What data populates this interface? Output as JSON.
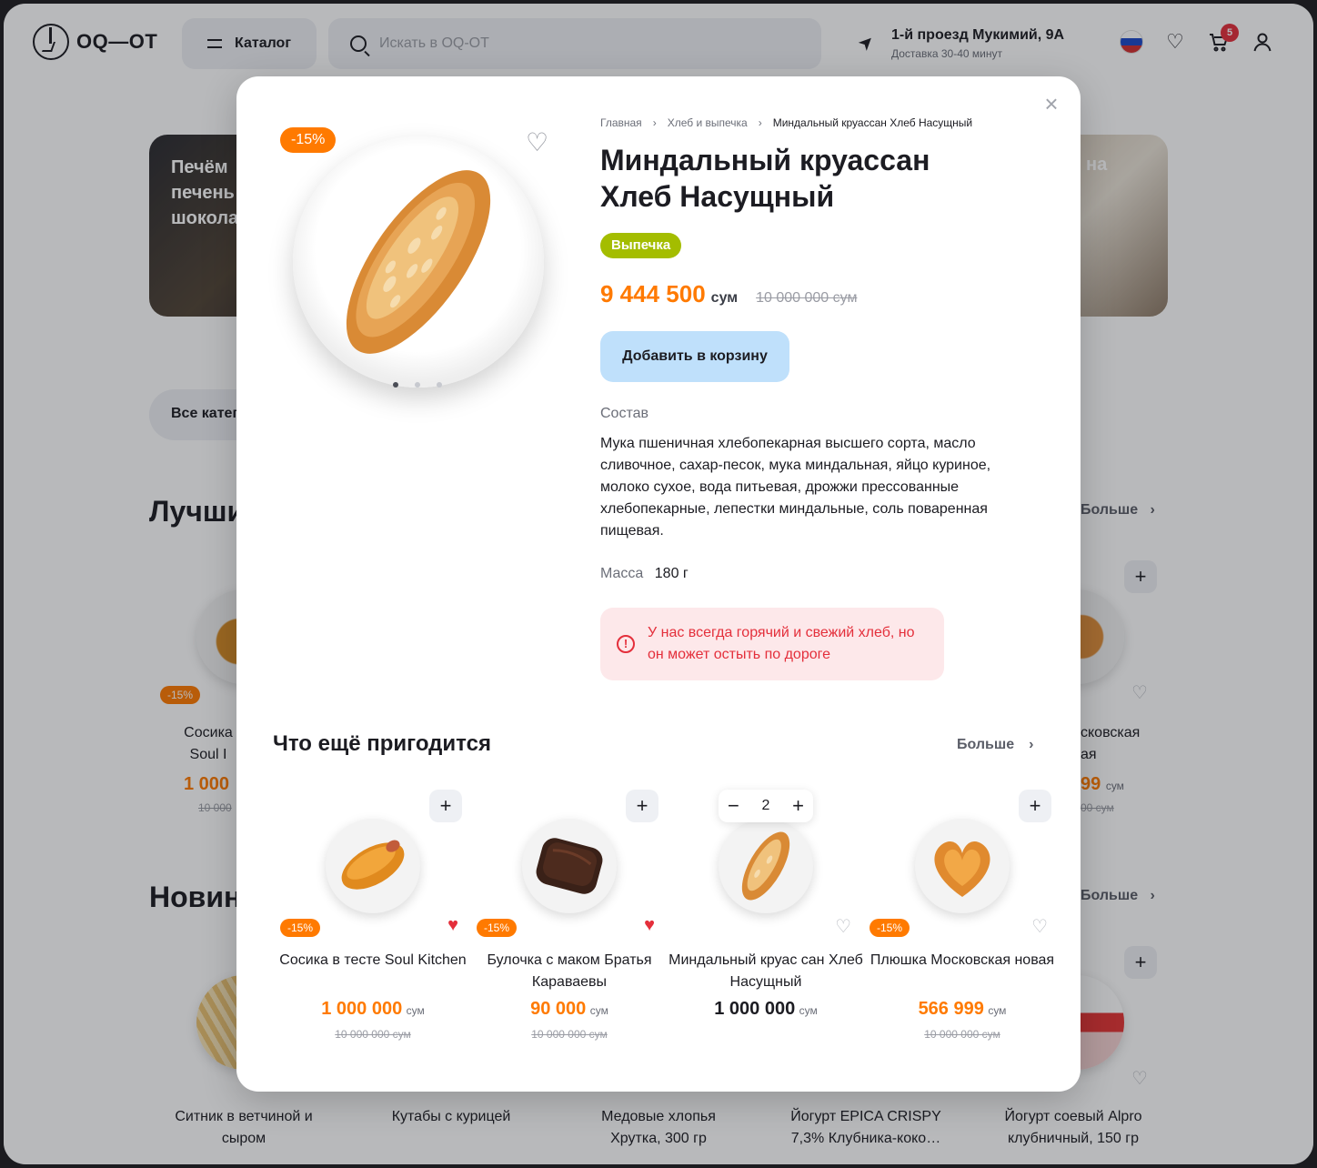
{
  "header": {
    "logo": "OQ—OT",
    "catalog_label": "Каталог",
    "search_placeholder": "Искать в OQ-OT",
    "address": "1-й проезд Мукимий, 9A",
    "delivery": "Доставка 30-40 минут",
    "cart_count": "5"
  },
  "background": {
    "banner_left": "Печём печень шокола",
    "banner_right": "на",
    "categories_pill": "Все катег",
    "section_best": "Лучши",
    "section_new": "Новин",
    "more": "Больше",
    "left_card": {
      "discount": "-15%",
      "name": "Сосика Soul I",
      "price": "1 000",
      "old": "10 000"
    },
    "right_card": {
      "name": "сковская ая",
      "price": "99",
      "currency": "сум",
      "old": "00 сум"
    },
    "bottom_items": [
      "Ситник в ветчиной и сыром",
      "Кутабы с курицей",
      "Медовые хлопья Хрутка, 300 гр",
      "Йогурт EPICA CRISPY 7,3% Клубника-коко…",
      "Йогурт соевый Alpro клубничный, 150 гр"
    ]
  },
  "modal": {
    "discount": "-15%",
    "breadcrumb": [
      "Главная",
      "Хлеб и выпечка",
      "Миндальный круассан Хлеб Насущный"
    ],
    "title": "Миндальный круассан Хлеб Насущный",
    "tag": "Выпечка",
    "price": "9 444 500",
    "currency": "сум",
    "old_price": "10 000 000 сум",
    "add_to_cart": "Добавить в корзину",
    "composition_label": "Состав",
    "composition": "Мука пшеничная хлебопекарная высшего сорта, масло сливочное, сахар-песок, мука миндальная, яйцо куриное, молоко сухое, вода питьевая, дрожжи прессованные хлебопекарные, лепестки миндальные, соль поваренная пищевая.",
    "mass_label": "Масса",
    "mass_value": "180 г",
    "notice": "У нас всегда горячий и свежий хлеб, но он может остыть по дороге",
    "gallery_index": 1,
    "gallery_count": 3,
    "recommend_title": "Что ещё пригодится",
    "recommend_more": "Больше",
    "recommendations": [
      {
        "name": "Сосика в тесте Soul Kitchen",
        "price": "1 000 000",
        "currency": "сум",
        "old": "10 000 000 сум",
        "discount": "-15%",
        "favorite": true
      },
      {
        "name": "Булочка с маком Братья Караваевы",
        "price": "90 000",
        "currency": "сум",
        "old": "10 000 000 сум",
        "discount": "-15%",
        "favorite": true
      },
      {
        "name": "Миндальный круас сан Хлеб Насущный",
        "price": "1 000 000",
        "currency": "сум",
        "old": "",
        "discount": "",
        "favorite": false,
        "quantity": "2"
      },
      {
        "name": "Плюшка Московская новая",
        "price": "566 999",
        "currency": "сум",
        "old": "10 000 000 сум",
        "discount": "-15%",
        "favorite": false
      }
    ]
  },
  "colors": {
    "accent": "#ff7a00",
    "tag": "#a4bd00",
    "danger": "#e42f3b",
    "button": "#bfe0fb"
  },
  "icons": [
    "search-icon",
    "location-arrow-icon",
    "heart-icon",
    "cart-icon",
    "user-icon",
    "close-icon",
    "chevron-right-icon",
    "plus-icon",
    "minus-icon",
    "alert-icon"
  ]
}
